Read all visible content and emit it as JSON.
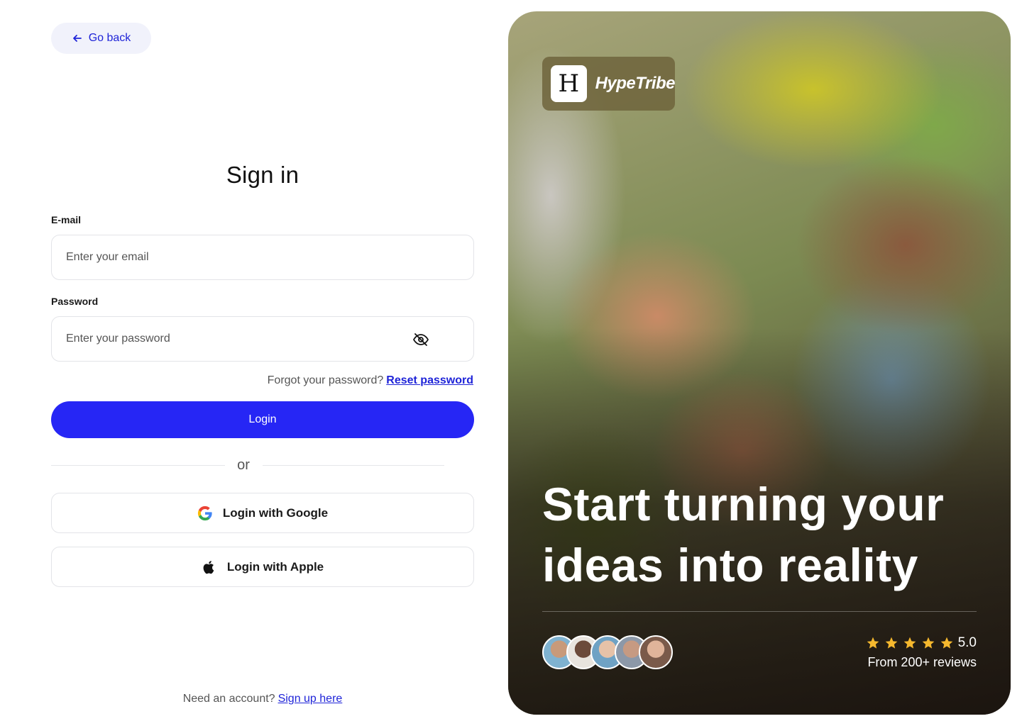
{
  "nav": {
    "back_label": "Go back"
  },
  "form": {
    "title": "Sign in",
    "email": {
      "label": "E-mail",
      "placeholder": "Enter your email",
      "value": ""
    },
    "password": {
      "label": "Password",
      "placeholder": "Enter your password",
      "value": ""
    },
    "forgot_text": "Forgot your password?",
    "reset_link": "Reset password",
    "login_label": "Login",
    "divider_text": "or",
    "google_label": "Login with Google",
    "apple_label": "Login with Apple",
    "signup_text": "Need an account?",
    "signup_link": "Sign up here"
  },
  "hero": {
    "brand_logo_letter": "H",
    "brand_name": "HypeTribe",
    "headline": "Start turning your ideas into reality",
    "rating_value": "5.0",
    "stars": 5,
    "reviews_text": "From 200+ reviews",
    "avatar_count": 5
  },
  "colors": {
    "accent": "#2626f5",
    "link": "#1f24d8",
    "star": "#f5b82e"
  },
  "icons": [
    "arrow-left-icon",
    "eye-off-icon",
    "google-icon",
    "apple-icon",
    "star-icon"
  ]
}
